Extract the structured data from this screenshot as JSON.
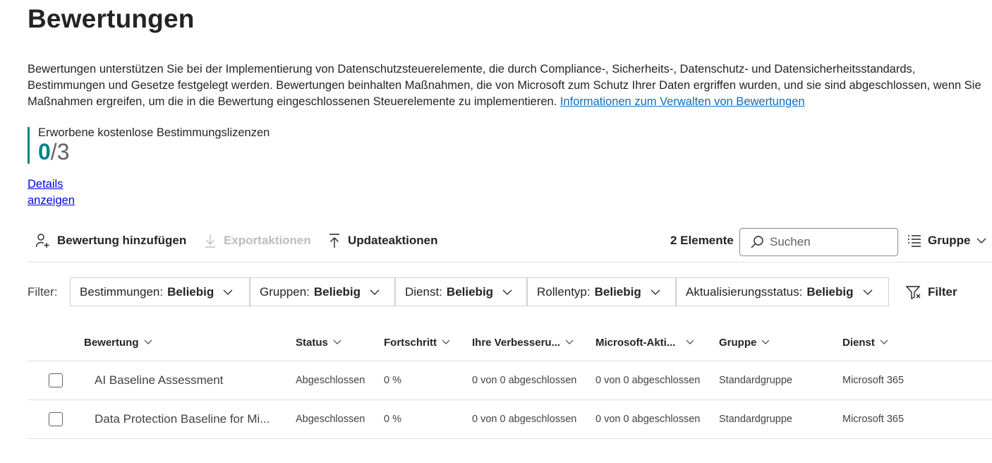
{
  "page": {
    "title": "Bewertungen",
    "description": "Bewertungen unterstützen Sie bei der Implementierung von Datenschutzsteuerelemente, die durch Compliance-, Sicherheits-, Datenschutz- und Datensicherheitsstandards, Bestimmungen und Gesetze festgelegt werden. Bewertungen beinhalten Maßnahmen, die von Microsoft zum Schutz Ihrer Daten ergriffen wurden, und sie sind abgeschlossen, wenn Sie Maßnahmen ergreifen, um die in die Bewertung eingeschlossenen Steuerelemente zu implementieren. ",
    "info_link": "Informationen zum Verwalten von Bewertungen"
  },
  "license": {
    "label": "Erworbene kostenlose Bestimmungslizenzen",
    "current": "0",
    "separator": "/",
    "total": "3",
    "accent_color": "#038387"
  },
  "details_link": "Details anzeigen",
  "toolbar": {
    "add_label": "Bewertung hinzufügen",
    "export_label": "Exportaktionen",
    "update_label": "Updateaktionen",
    "item_count": "2 Elemente",
    "search_placeholder": "Suchen",
    "group_label": "Gruppe",
    "icons": [
      "add-person-icon",
      "download-icon",
      "upload-icon",
      "search-icon",
      "group-list-icon",
      "chevron-down-icon"
    ]
  },
  "filters": {
    "label": "Filter:",
    "items": [
      {
        "name": "Bestimmungen:",
        "value": "Beliebig"
      },
      {
        "name": "Gruppen:",
        "value": "Beliebig"
      },
      {
        "name": "Dienst:",
        "value": "Beliebig"
      },
      {
        "name": "Rollentyp:",
        "value": "Beliebig"
      },
      {
        "name": "Aktualisierungsstatus:",
        "value": "Beliebig"
      }
    ],
    "filter_button": "Filter"
  },
  "table": {
    "columns": [
      "Bewertung",
      "Status",
      "Fortschritt",
      "Ihre Verbesseru...",
      "Microsoft-Akti...",
      "Gruppe",
      "Dienst"
    ],
    "rows": [
      [
        "AI Baseline Assessment",
        "Abgeschlossen",
        "0 %",
        "0 von 0 abgeschlossen",
        "0 von 0 abgeschlossen",
        "Standardgruppe",
        "Microsoft 365"
      ],
      [
        "Data Protection Baseline for Mi...",
        "Abgeschlossen",
        "0 %",
        "0 von 0 abgeschlossen",
        "0 von 0 abgeschlossen",
        "Standardgruppe",
        "Microsoft 365"
      ]
    ]
  }
}
